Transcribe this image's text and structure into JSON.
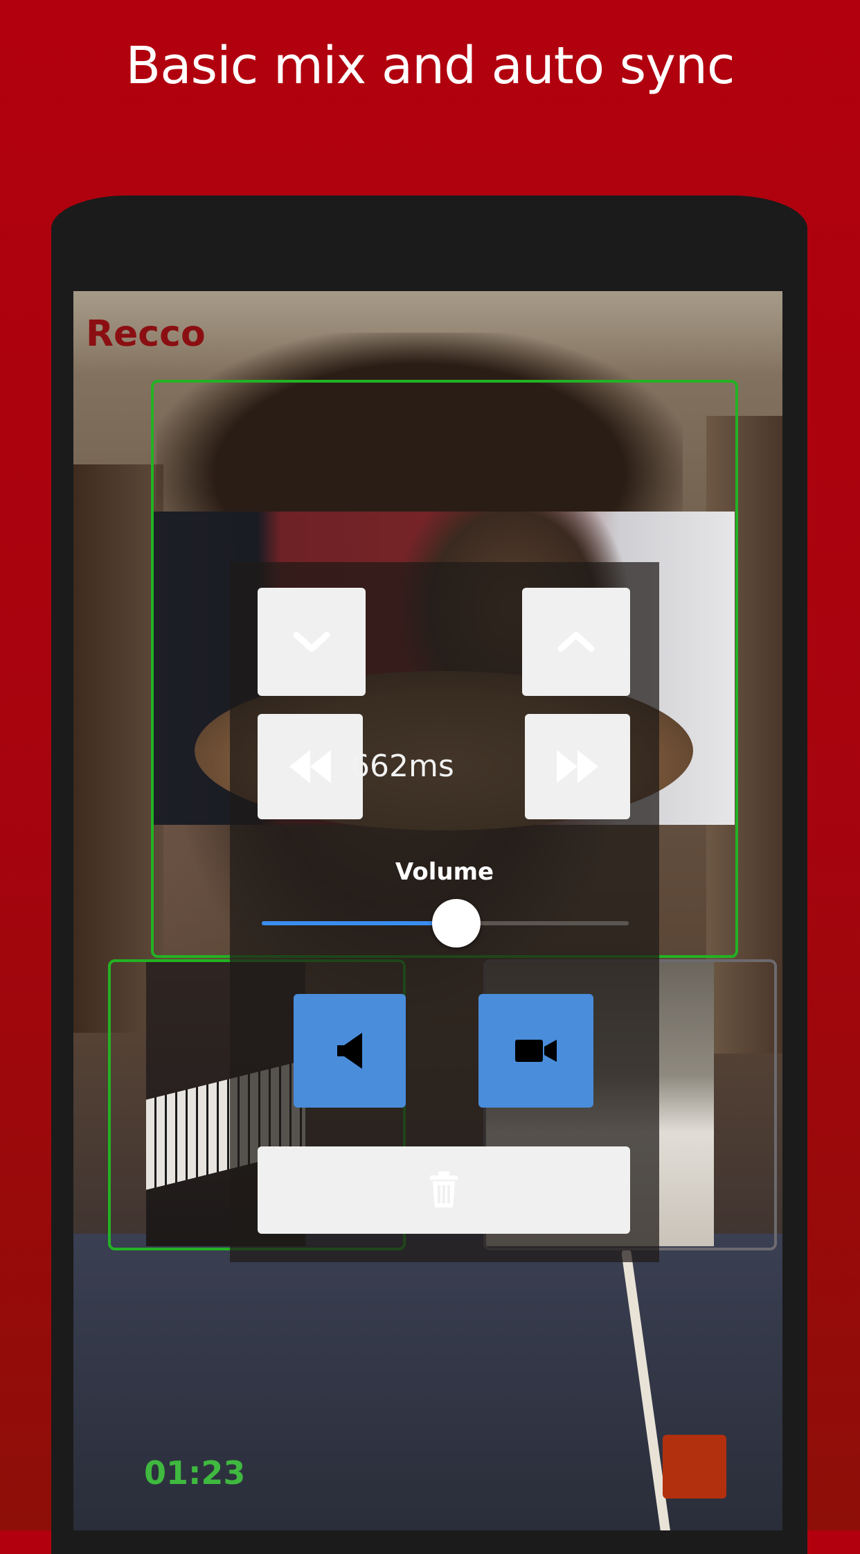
{
  "headline": "Basic mix and auto sync",
  "app": {
    "title": "Recco"
  },
  "sync_panel": {
    "offset_value": "662ms",
    "buttons": {
      "move_down": "chevron-down-icon",
      "move_up": "chevron-up-icon",
      "rewind": "rewind-icon",
      "fast_forward": "fast-forward-icon"
    },
    "volume": {
      "label": "Volume",
      "level": 0.53
    },
    "media_buttons": {
      "audio": "speaker-icon",
      "video": "video-camera-icon"
    },
    "delete_button": "trash-icon"
  },
  "recording": {
    "elapsed": "01:23",
    "stop_button": "stop-icon"
  },
  "colors": {
    "background": "#b2000e",
    "accent_blue": "#4a8ddb",
    "selection_green": "#23b223",
    "timer_green": "#3fb93f",
    "record_red": "#b3300f",
    "title_red": "#8b0f12"
  }
}
